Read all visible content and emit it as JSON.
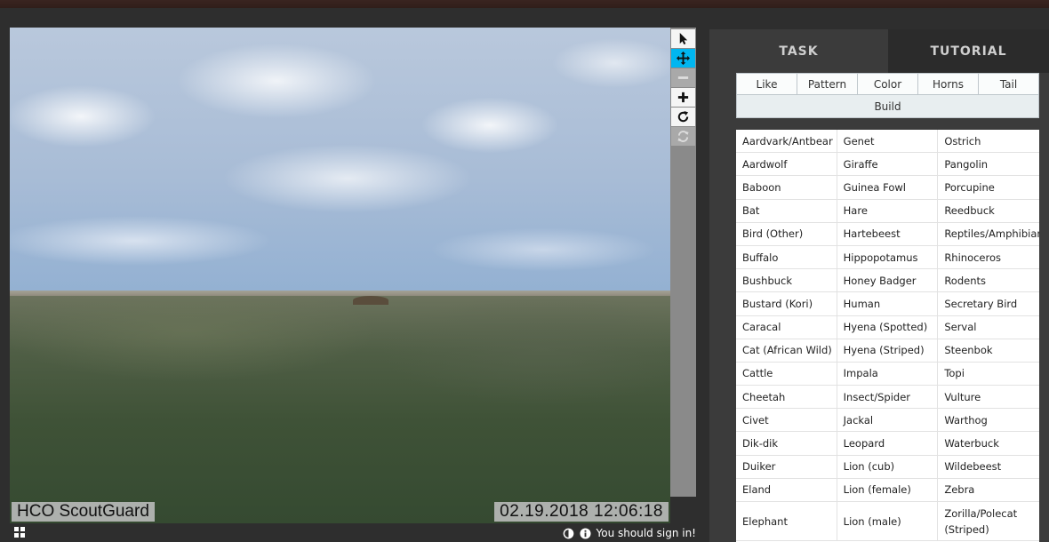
{
  "viewer": {
    "camera_label": "HCO ScoutGuard",
    "timestamp_label": "02.19.2018 12:06:18",
    "sign_in_text": "You should sign in!"
  },
  "tools": [
    "pointer-icon",
    "move-icon",
    "zoom-out-icon",
    "zoom-in-icon",
    "rotate-icon",
    "reset-icon"
  ],
  "task_panel": {
    "tabs": [
      "TASK",
      "TUTORIAL"
    ],
    "filters": [
      "Like",
      "Pattern",
      "Color",
      "Horns",
      "Tail"
    ],
    "build_label": "Build",
    "species_rows": [
      [
        "Aardvark/Antbear",
        "Genet",
        "Ostrich"
      ],
      [
        "Aardwolf",
        "Giraffe",
        "Pangolin"
      ],
      [
        "Baboon",
        "Guinea Fowl",
        "Porcupine"
      ],
      [
        "Bat",
        "Hare",
        "Reedbuck"
      ],
      [
        "Bird (Other)",
        "Hartebeest",
        "Reptiles/Amphibians"
      ],
      [
        "Buffalo",
        "Hippopotamus",
        "Rhinoceros"
      ],
      [
        "Bushbuck",
        "Honey Badger",
        "Rodents"
      ],
      [
        "Bustard (Kori)",
        "Human",
        "Secretary Bird"
      ],
      [
        "Caracal",
        "Hyena (Spotted)",
        "Serval"
      ],
      [
        "Cat (African Wild)",
        "Hyena (Striped)",
        "Steenbok"
      ],
      [
        "Cattle",
        "Impala",
        "Topi"
      ],
      [
        "Cheetah",
        "Insect/Spider",
        "Vulture"
      ],
      [
        "Civet",
        "Jackal",
        "Warthog"
      ],
      [
        "Dik-dik",
        "Leopard",
        "Waterbuck"
      ],
      [
        "Duiker",
        "Lion (cub)",
        "Wildebeest"
      ],
      [
        "Eland",
        "Lion (female)",
        "Zebra"
      ],
      [
        "Elephant",
        "Lion (male)",
        "Zorilla/Polecat (Striped)"
      ]
    ]
  },
  "colors": {
    "background": "#2e2e2e",
    "active_tool": "#00b6f0",
    "panel": "#3b3b3b"
  }
}
